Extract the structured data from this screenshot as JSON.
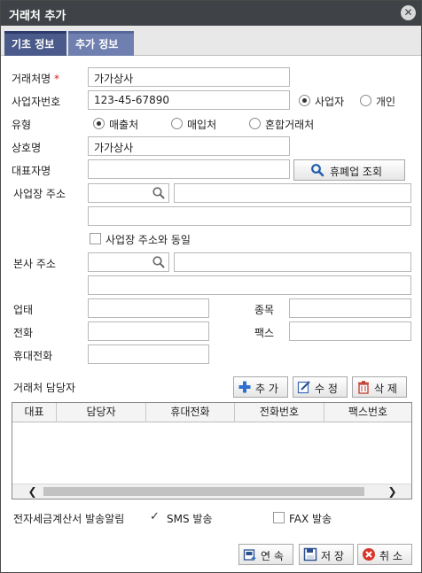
{
  "window": {
    "title": "거래처 추가"
  },
  "tabs": [
    "기초 정보",
    "추가 정보"
  ],
  "form": {
    "name_label": "거래처명",
    "required_mark": "*",
    "name_value": "가가상사",
    "bizno_label": "사업자번호",
    "bizno_value": "123-45-67890",
    "biztype_options": [
      "사업자",
      "개인"
    ],
    "biztype_selected": "사업자",
    "type_label": "유형",
    "type_options": [
      "매출처",
      "매입처",
      "혼합거래처"
    ],
    "type_selected": "매출처",
    "company_label": "상호명",
    "company_value": "가가상사",
    "ceo_label": "대표자명",
    "ceo_value": "",
    "closure_button": "휴폐업 조회",
    "biz_addr_label": "사업장 주소",
    "same_addr_label": "사업장 주소와 동일",
    "hq_addr_label": "본사 주소",
    "business_label": "업태",
    "item_label": "종목",
    "phone_label": "전화",
    "fax_label": "팩스",
    "mobile_label": "휴대전화"
  },
  "contacts": {
    "section_label": "거래처 담당자",
    "add_button": "추 가",
    "edit_button": "수 정",
    "delete_button": "삭 제",
    "columns": [
      "대표",
      "담당자",
      "휴대전화",
      "전화번호",
      "팩스번호"
    ],
    "rows": []
  },
  "notify": {
    "label": "전자세금계산서 발송알림",
    "sms_label": "SMS 발송",
    "sms_checked": true,
    "fax_label": "FAX 발송",
    "fax_checked": false
  },
  "footer": {
    "continue_button": "연 속",
    "save_button": "저 장",
    "cancel_button": "취 소"
  },
  "icons": {
    "close": "close-icon",
    "search": "search-icon",
    "plus": "plus-icon",
    "edit": "edit-icon",
    "trash": "trash-icon",
    "continue": "continue-icon",
    "save": "floppy-icon",
    "cancel": "cancel-icon"
  },
  "colors": {
    "titlebar": "#3f4247",
    "tab_active": "#4a5a8a",
    "tab_inactive": "#6f7fb0",
    "plus_icon": "#2f6fd0",
    "cancel_icon": "#d9352b",
    "required": "#dd2222"
  }
}
